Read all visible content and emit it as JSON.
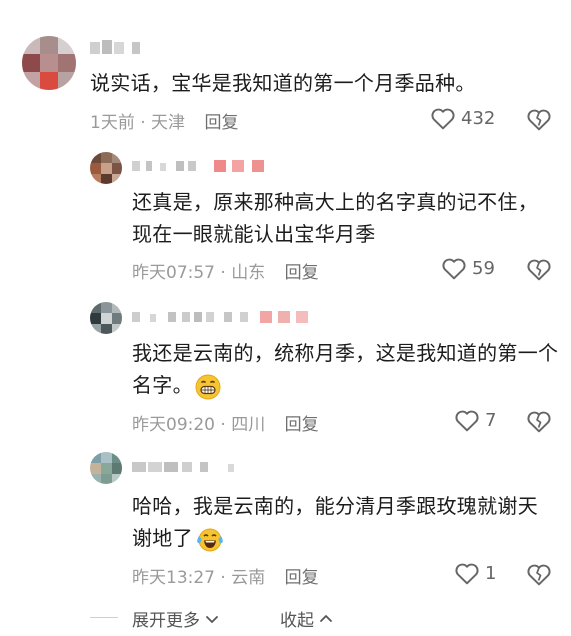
{
  "comments": [
    {
      "text": "说实话，宝华是我知道的第一个月季品种。",
      "time": "1天前",
      "location": "天津",
      "reply_label": "回复",
      "likes": "432",
      "username_visible": false
    },
    {
      "text": "还真是，原来那种高大上的名字真的记不住，现在一眼就能认出宝华月季",
      "time": "昨天07:57",
      "location": "山东",
      "reply_label": "回复",
      "likes": "59",
      "username_visible": false
    },
    {
      "text": "我还是云南的，统称月季，这是我知道的第一个名字。",
      "emoji": "grinning-face",
      "time": "昨天09:20",
      "location": "四川",
      "reply_label": "回复",
      "likes": "7",
      "username_visible": false
    },
    {
      "text": "哈哈，我是云南的，能分清月季跟玫瑰就谢天谢地了",
      "emoji": "tears-of-joy",
      "time": "昨天13:27",
      "location": "云南",
      "reply_label": "回复",
      "likes": "1",
      "username_visible": false
    }
  ],
  "footer": {
    "expand_label": "展开更多",
    "collapse_label": "收起"
  },
  "colors": {
    "meta_gray": "#9a9a9a",
    "text": "#1c1c1c",
    "icon_gray": "#666666"
  }
}
